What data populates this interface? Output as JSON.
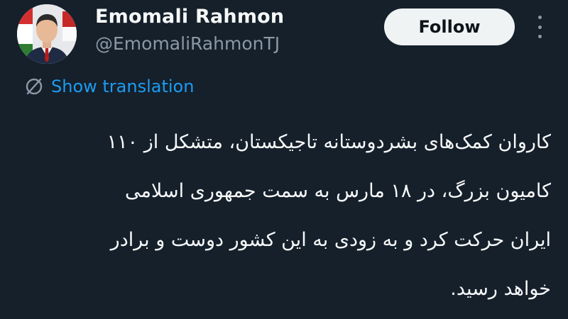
{
  "author": {
    "display_name": "Emomali Rahmon",
    "handle": "@EmomaliRahmonTJ",
    "avatar_icon": "profile-photo"
  },
  "actions": {
    "follow_label": "Follow",
    "more_icon": "more-options-icon"
  },
  "translation": {
    "icon": "translate-icon",
    "label": "Show translation"
  },
  "tweet": {
    "lines": [
      "کاروان کمک‌های بشردوستانه تاجیکستان، متشکل از ۱۱۰",
      "کامیون بزرگ، در ۱۸ مارس به سمت جمهوری اسلامی",
      "ایران حرکت کرد و به زودی به این کشور دوست و برادر",
      "خواهد رسید."
    ]
  },
  "colors": {
    "background": "#15202b",
    "primary_text": "#f7f9f9",
    "secondary_text": "#8b98a5",
    "link": "#1d9bf0",
    "button_bg": "#eff3f4"
  }
}
